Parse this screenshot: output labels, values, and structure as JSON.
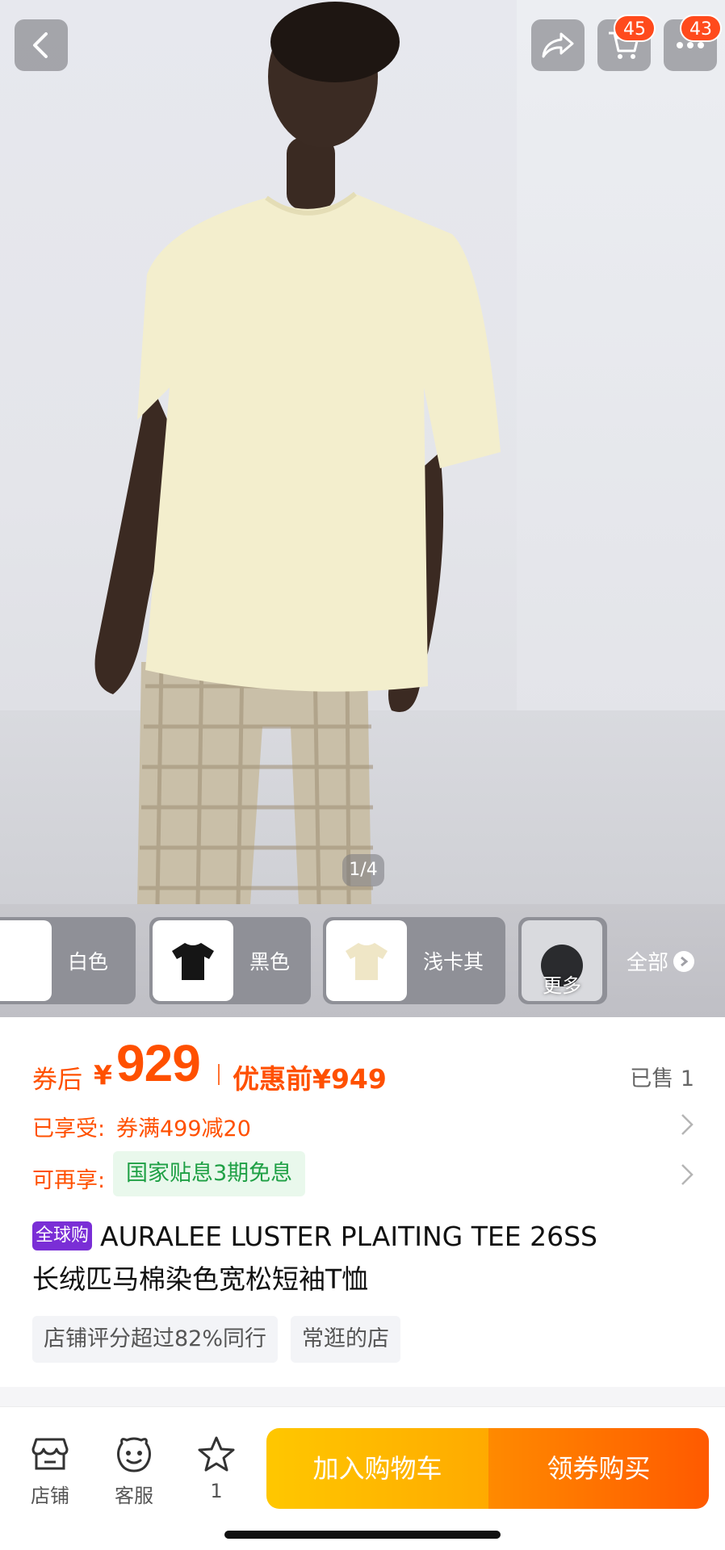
{
  "gallery": {
    "page_indicator": "1/4",
    "cart_badge_count": "45",
    "more_badge_count": "43",
    "icons": [
      "back-icon",
      "share-icon",
      "cart-icon",
      "more-icon"
    ]
  },
  "color_options": {
    "items": [
      {
        "label": "白色",
        "swatch": "#ffffff"
      },
      {
        "label": "黑色",
        "swatch": "#151515"
      },
      {
        "label": "浅卡其",
        "swatch": "#efe6c6"
      }
    ],
    "more_label": "更多",
    "all_label": "全部"
  },
  "price": {
    "coupon_prefix": "券后",
    "currency": "¥",
    "amount": "929",
    "original": "优惠前¥949",
    "sold": "已售 1"
  },
  "promotions": {
    "applied_key": "已享受:",
    "applied_value": "券满499减20",
    "available_key": "可再享:",
    "available_value": "国家贴息3期免息"
  },
  "product": {
    "global_tag": "全球购",
    "title_line1": "AURALEE LUSTER PLAITING TEE 26SS",
    "title_line2": "长绒匹马棉染色宽松短袖T恤"
  },
  "shop_tags": [
    "店铺评分超过82%同行",
    "常逛的店"
  ],
  "bottom_bar": {
    "shop_label": "店铺",
    "service_label": "客服",
    "favorite_count": "1",
    "add_to_cart": "加入购物车",
    "buy_with_coupon": "领券购买"
  },
  "colors": {
    "accent": "#ff5000",
    "green_tag": "#1fa045",
    "global_tag": "#7a2ed6",
    "cta_yellow": "#ffb800",
    "cta_orange": "#ff6a00"
  }
}
